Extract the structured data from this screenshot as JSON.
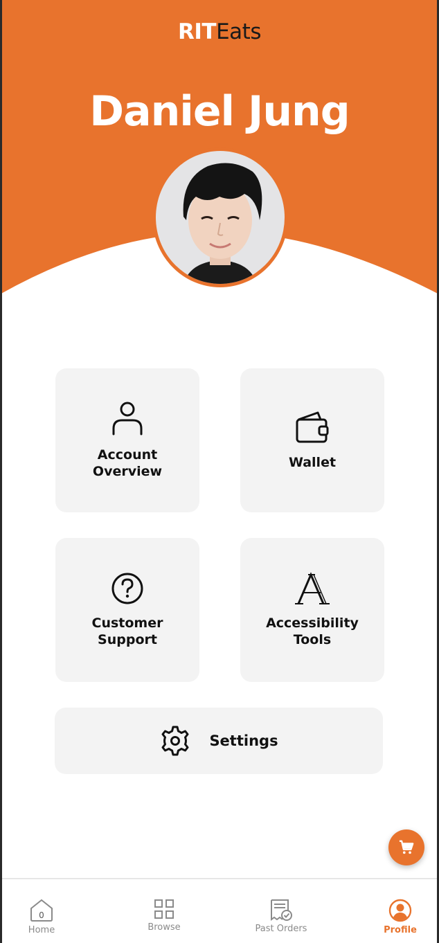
{
  "app": {
    "title_part1": "RIT",
    "title_part2": "Eats",
    "brand_color": "#E8732D"
  },
  "profile": {
    "name": "Daniel Jung",
    "avatar": "profile-photo"
  },
  "menu": {
    "account_overview": {
      "label": "Account\nOverview",
      "icon": "person-icon"
    },
    "wallet": {
      "label": "Wallet",
      "icon": "wallet-icon"
    },
    "customer_support": {
      "label": "Customer\nSupport",
      "icon": "question-circle-icon"
    },
    "accessibility_tools": {
      "label": "Accessibility\nTools",
      "icon": "font-a-icon"
    },
    "settings": {
      "label": "Settings",
      "icon": "gear-icon"
    }
  },
  "cart": {
    "icon": "cart-icon"
  },
  "nav": {
    "home": {
      "label": "Home",
      "badge": "0",
      "icon": "home-icon"
    },
    "browse": {
      "label": "Browse",
      "icon": "grid-icon"
    },
    "past_orders": {
      "label": "Past Orders",
      "icon": "receipt-check-icon"
    },
    "profile": {
      "label": "Profile",
      "icon": "profile-icon",
      "active": true
    }
  }
}
